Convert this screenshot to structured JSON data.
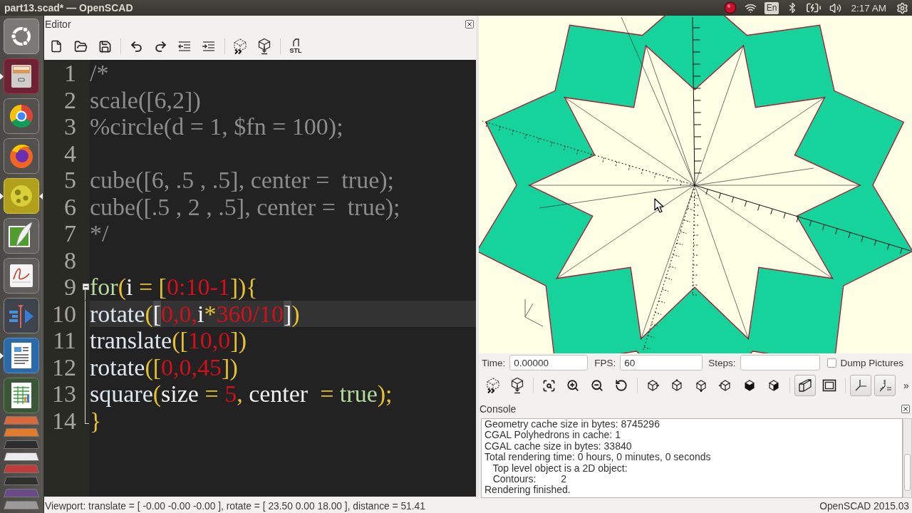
{
  "top_bar": {
    "title": "part13.scad* — OpenSCAD",
    "keyboard_layout": "En",
    "clock": "2:17 AM"
  },
  "launcher": [
    {
      "running": false,
      "focused": false
    },
    {
      "running": true,
      "focused": false
    },
    {
      "running": false,
      "focused": false
    },
    {
      "running": false,
      "focused": false
    },
    {
      "running": true,
      "focused": true
    },
    {
      "running": false,
      "focused": false
    },
    {
      "running": false,
      "focused": false
    },
    {
      "running": false,
      "focused": false
    },
    {
      "running": true,
      "focused": false
    },
    {
      "running": false,
      "focused": false
    }
  ],
  "editor": {
    "title": "Editor",
    "export_label": "STL",
    "lines": [
      {
        "number": "1",
        "current": false,
        "tokens": [
          {
            "text": "/*",
            "kind": "comment"
          }
        ]
      },
      {
        "number": "2",
        "current": false,
        "tokens": [
          {
            "text": "scale([6,2])",
            "kind": "comment"
          }
        ]
      },
      {
        "number": "3",
        "current": false,
        "tokens": [
          {
            "text": "%circle(d = 1, $fn = 100);",
            "kind": "comment"
          }
        ]
      },
      {
        "number": "4",
        "current": false
      },
      {
        "number": "5",
        "current": false,
        "tokens": [
          {
            "text": "cube([6, .5 , .5], center =  true);",
            "kind": "comment"
          }
        ]
      },
      {
        "number": "6",
        "current": false,
        "tokens": [
          {
            "text": "cube([.5 , 2 , .5], center =  true);",
            "kind": "comment"
          }
        ]
      },
      {
        "number": "7",
        "current": false,
        "tokens": [
          {
            "text": "*/",
            "kind": "comment"
          }
        ]
      },
      {
        "number": "8",
        "current": false
      },
      {
        "number": "9",
        "current": false,
        "fold": {
          "expanded": true
        },
        "tokens": [
          {
            "text": "for",
            "kind": "keyword"
          },
          {
            "text": "(",
            "kind": "punct"
          },
          {
            "text": "i",
            "kind": "ident"
          },
          {
            "text": " = [",
            "kind": "punct"
          },
          {
            "text": "0:10-1",
            "kind": "number"
          },
          {
            "text": "]){",
            "kind": "punct"
          }
        ]
      },
      {
        "number": "10",
        "current": true,
        "tokens": [
          {
            "text": "rotate",
            "kind": "builtin"
          },
          {
            "text": "(",
            "kind": "punct"
          },
          {
            "text": "[",
            "kind": "matched_bracket"
          },
          {
            "text": "0,0,",
            "kind": "number"
          },
          {
            "text": "i",
            "kind": "ident"
          },
          {
            "text": "*",
            "kind": "punct"
          },
          {
            "text": "360/10",
            "kind": "number"
          },
          {
            "text": "]",
            "kind": "matched_bracket"
          },
          {
            "text": ")",
            "kind": "punct"
          }
        ]
      },
      {
        "number": "11",
        "current": false,
        "tokens": [
          {
            "text": "translate",
            "kind": "builtin"
          },
          {
            "text": "([",
            "kind": "punct"
          },
          {
            "text": "10,0",
            "kind": "number"
          },
          {
            "text": "])",
            "kind": "punct"
          }
        ]
      },
      {
        "number": "12",
        "current": false,
        "tokens": [
          {
            "text": "rotate",
            "kind": "builtin"
          },
          {
            "text": "([",
            "kind": "punct"
          },
          {
            "text": "0,0,45",
            "kind": "number"
          },
          {
            "text": "])",
            "kind": "punct"
          }
        ]
      },
      {
        "number": "13",
        "current": false,
        "tokens": [
          {
            "text": "square",
            "kind": "builtin"
          },
          {
            "text": "(",
            "kind": "punct"
          },
          {
            "text": "size",
            "kind": "ident"
          },
          {
            "text": " = ",
            "kind": "punct"
          },
          {
            "text": "5",
            "kind": "number"
          },
          {
            "text": ",",
            "kind": "punct"
          },
          {
            "text": " center",
            "kind": "ident"
          },
          {
            "text": "  = ",
            "kind": "punct"
          },
          {
            "text": "true",
            "kind": "keyword"
          },
          {
            "text": ");",
            "kind": "punct"
          }
        ]
      },
      {
        "number": "14",
        "current": false,
        "tokens": [
          {
            "text": "}",
            "kind": "punct"
          }
        ]
      }
    ]
  },
  "animation": {
    "time_label": "Time:",
    "time_value": "0.00000",
    "fps_label": "FPS:",
    "fps_value": "60",
    "steps_label": "Steps:",
    "dump_pictures": {
      "label": "Dump Pictures",
      "checked": false
    }
  },
  "view_toolbar": {
    "projection": [
      {
        "selected": true
      },
      {
        "selected": false
      }
    ],
    "axes_toggles": [
      {
        "on": true
      },
      {
        "on": true
      }
    ],
    "overflow": "»"
  },
  "console": {
    "title": "Console",
    "lines": [
      "Geometry cache size in bytes: 8745296",
      "CGAL Polyhedrons in cache: 1",
      "CGAL cache size in bytes: 33840",
      "Total rendering time: 0 hours, 0 minutes, 0 seconds",
      "   Top level object is a 2D object:",
      "   Contours:         2",
      "Rendering finished."
    ]
  },
  "status_bar": {
    "viewport": "Viewport: translate = [ -0.00 -0.00 -0.00 ], rotate = [ 23.50 0.00 18.00 ], distance = 51.41",
    "version": "OpenSCAD 2015.03"
  }
}
